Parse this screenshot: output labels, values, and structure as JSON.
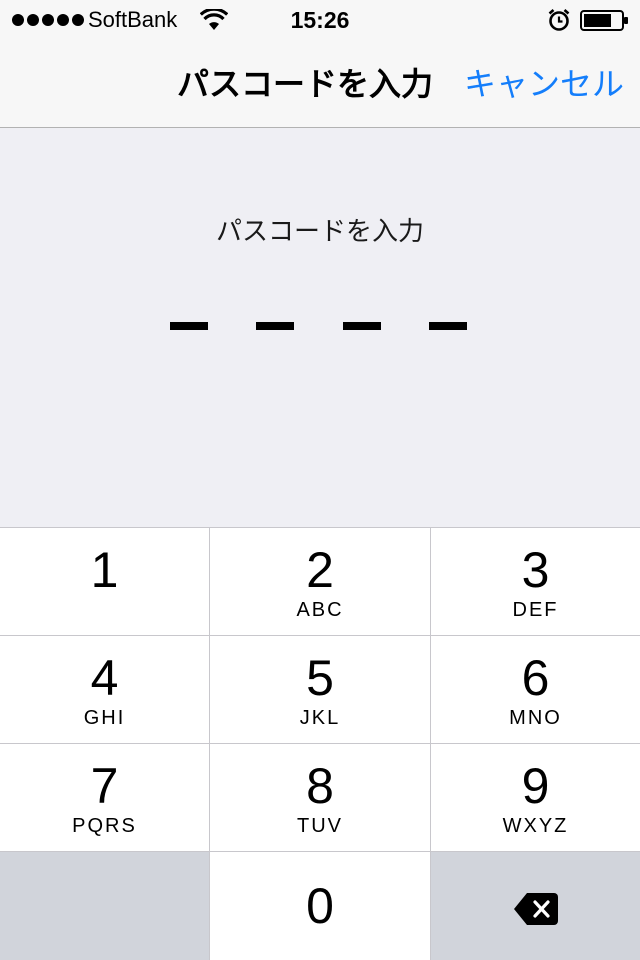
{
  "status_bar": {
    "carrier": "SoftBank",
    "time": "15:26",
    "battery_level": 0.75,
    "signal_bars": 5,
    "icons": [
      "signal-dots-icon",
      "wifi-icon",
      "alarm-icon",
      "battery-icon"
    ]
  },
  "nav": {
    "title": "パスコードを入力",
    "cancel_label": "キャンセル",
    "accent_color": "#147efb"
  },
  "passcode": {
    "prompt": "パスコードを入力",
    "digits_entered": 0,
    "digits_total": 4
  },
  "keypad": {
    "keys": [
      {
        "num": "1",
        "letters": ""
      },
      {
        "num": "2",
        "letters": "ABC"
      },
      {
        "num": "3",
        "letters": "DEF"
      },
      {
        "num": "4",
        "letters": "GHI"
      },
      {
        "num": "5",
        "letters": "JKL"
      },
      {
        "num": "6",
        "letters": "MNO"
      },
      {
        "num": "7",
        "letters": "PQRS"
      },
      {
        "num": "8",
        "letters": "TUV"
      },
      {
        "num": "9",
        "letters": "WXYZ"
      }
    ],
    "zero": {
      "num": "0"
    },
    "delete_icon": "backspace-icon"
  }
}
